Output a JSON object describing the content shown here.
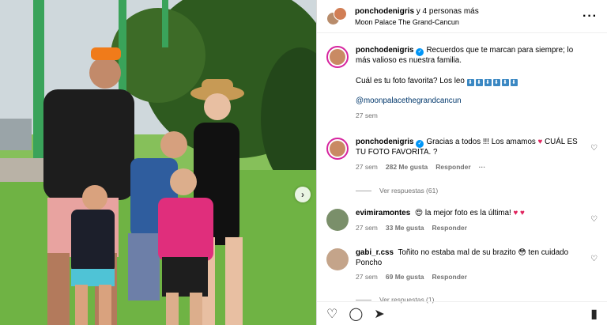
{
  "header": {
    "username": "ponchodenigris",
    "with_text": "y 4 personas más",
    "location": "Moon Palace The Grand-Cancun",
    "more_icon": "more-options-icon"
  },
  "caption": {
    "username": "ponchodenigris",
    "text": "Recuerdos que te marcan para siempre; lo más valioso es nuestra familia.",
    "question": "Cuál es tu foto favorita? Los leo",
    "arrows": [
      "⬇",
      "⬇",
      "⬇",
      "⬇",
      "⬇",
      "⬇"
    ],
    "mention": "@moonpalacethegrandcancun",
    "time": "27 sem"
  },
  "comments": [
    {
      "username": "ponchodenigris",
      "verified": true,
      "text_a": "Gracias a todos !!! Los amamos",
      "heart": "♥",
      "text_b": "CUÁL ES TU FOTO FAVORITA. ?",
      "time": "27 sem",
      "likes": "282 Me gusta",
      "reply": "Responder",
      "options": "···",
      "view_replies": "Ver respuestas (61)"
    },
    {
      "username": "evimiramontes",
      "emoji": "😍",
      "text": "la mejor foto es la última!",
      "hearts": "♥ ♥",
      "time": "27 sem",
      "likes": "33 Me gusta",
      "reply": "Responder"
    },
    {
      "username": "gabi_r.css",
      "text": "Toñito no estaba mal de su brazito",
      "emoji": "😳",
      "text_b": "ten cuidado Poncho",
      "time": "27 sem",
      "likes": "69 Me gusta",
      "reply": "Responder",
      "view_replies": "Ver respuestas (1)"
    }
  ],
  "photo": {
    "next_icon": "›"
  },
  "actions": {
    "like_icon": "♡",
    "comment_icon": "◯",
    "share_icon": "➤",
    "save_icon": "▮"
  }
}
